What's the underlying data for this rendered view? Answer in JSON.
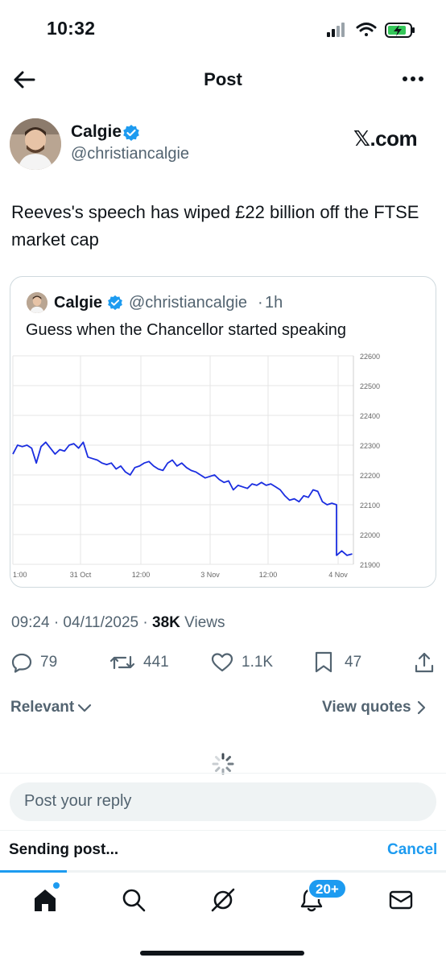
{
  "status_bar": {
    "time": "10:32"
  },
  "nav": {
    "title": "Post"
  },
  "post": {
    "author_name": "Calgie",
    "author_handle": "@christiancalgie",
    "source_label": "𝕏.com",
    "text": "Reeves's speech has wiped £22 billion off the FTSE market cap",
    "timestamp": "09:24 · 04/11/2025 · ",
    "views_count": "38K",
    "views_label": " Views"
  },
  "quote": {
    "author_name": "Calgie",
    "author_handle": "@christiancalgie",
    "separator": "·",
    "time": "1h",
    "text": "Guess when the Chancellor started speaking"
  },
  "chart_data": {
    "type": "line",
    "x_tick_labels": [
      "1:00",
      "31 Oct",
      "12:00",
      "3 Nov",
      "12:00",
      "4 Nov"
    ],
    "y_tick_labels": [
      "22600",
      "22500",
      "22400",
      "22300",
      "22200",
      "22100",
      "22000",
      "21900"
    ],
    "ylim": [
      21900,
      22600
    ],
    "grid": true,
    "color": "#1a2de0",
    "values": [
      22270,
      22300,
      22295,
      22300,
      22290,
      22240,
      22295,
      22310,
      22290,
      22270,
      22285,
      22280,
      22300,
      22305,
      22290,
      22310,
      22260,
      22255,
      22250,
      22240,
      22235,
      22240,
      22220,
      22230,
      22210,
      22200,
      22225,
      22230,
      22240,
      22245,
      22230,
      22220,
      22215,
      22240,
      22250,
      22230,
      22240,
      22225,
      22215,
      22210,
      22200,
      22190,
      22195,
      22200,
      22185,
      22175,
      22180,
      22150,
      22165,
      22160,
      22155,
      22170,
      22165,
      22175,
      22165,
      22170,
      22160,
      22150,
      22130,
      22115,
      22120,
      22110,
      22130,
      22125,
      22150,
      22145,
      22110,
      22100,
      22105,
      22100,
      21930,
      21945,
      21930,
      21935
    ]
  },
  "actions": {
    "replies": "79",
    "reposts": "441",
    "likes": "1.1K",
    "bookmarks": "47"
  },
  "filters": {
    "sort_label": "Relevant",
    "view_quotes_label": "View quotes"
  },
  "reply": {
    "placeholder": "Post your reply"
  },
  "sending": {
    "label": "Sending post...",
    "cancel_label": "Cancel",
    "progress": 0.15
  },
  "tab_bar": {
    "notifications_badge": "20+"
  },
  "colors": {
    "accent": "#1d9bf0",
    "text": "#0f1419",
    "muted": "#536471"
  }
}
